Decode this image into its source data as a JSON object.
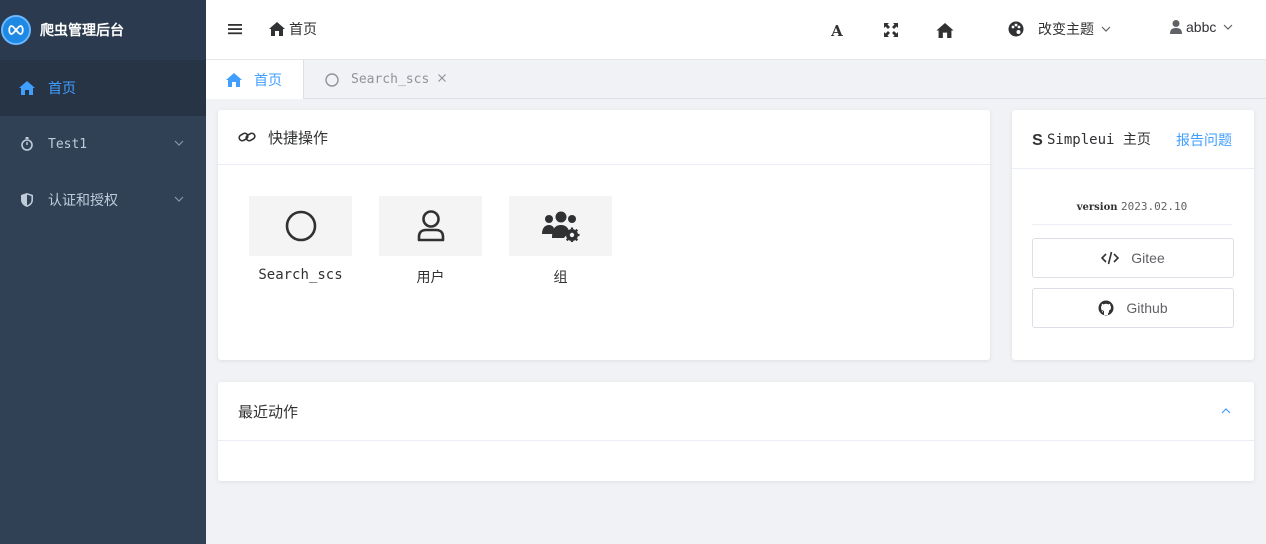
{
  "app": {
    "title": "爬虫管理后台"
  },
  "sidebar": {
    "items": [
      {
        "label": "首页",
        "icon": "home-icon",
        "active": true
      },
      {
        "label": "Test1",
        "icon": "stopwatch-icon",
        "active": false
      },
      {
        "label": "认证和授权",
        "icon": "shield-icon",
        "active": false
      }
    ]
  },
  "header": {
    "breadcrumb": "首页",
    "theme_label": "改变主题",
    "user_name": "abbc"
  },
  "tabs": [
    {
      "label": "首页"
    },
    {
      "label": "Search_scs"
    }
  ],
  "quick": {
    "title": "快捷操作",
    "items": [
      {
        "label": "Search_scs",
        "icon": "circle-icon"
      },
      {
        "label": "用户",
        "icon": "user-icon"
      },
      {
        "label": "组",
        "icon": "users-cog-icon"
      }
    ]
  },
  "simpleui": {
    "title": "Simpleui 主页",
    "report": "报告问题",
    "version_label": "version",
    "version_value": "2023.02.10",
    "gitee": "Gitee",
    "github": "Github"
  },
  "recent": {
    "title": "最近动作"
  },
  "colors": {
    "sidebar_bg": "#304156",
    "accent": "#409eff",
    "sidebar_text": "#bfcbd9"
  }
}
